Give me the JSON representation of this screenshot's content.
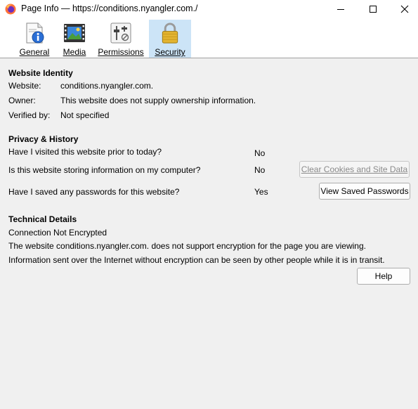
{
  "window": {
    "title": "Page Info — https://conditions.nyangler.com./",
    "icon": "firefox-icon",
    "minimize_icon": "minimize-icon",
    "maximize_icon": "maximize-icon",
    "close_icon": "close-icon"
  },
  "tabs": [
    {
      "label": "General",
      "icon": "general-page-icon",
      "selected": false
    },
    {
      "label": "Media",
      "icon": "media-film-icon",
      "selected": false
    },
    {
      "label": "Permissions",
      "icon": "permissions-sliders-icon",
      "selected": false
    },
    {
      "label": "Security",
      "icon": "padlock-icon",
      "selected": true
    }
  ],
  "identity": {
    "heading": "Website Identity",
    "website_label": "Website:",
    "website_value": "conditions.nyangler.com.",
    "owner_label": "Owner:",
    "owner_value": "This website does not supply ownership information.",
    "verified_label": "Verified by:",
    "verified_value": "Not specified"
  },
  "privacy": {
    "heading": "Privacy & History",
    "q1": "Have I visited this website prior to today?",
    "a1": "No",
    "q2": "Is this website storing information on my computer?",
    "a2": "No",
    "clear_button": "Clear Cookies and Site Data",
    "q3": "Have I saved any passwords for this website?",
    "a3": "Yes",
    "view_passwords_button": "View Saved Passwords"
  },
  "technical": {
    "heading": "Technical Details",
    "line1": "Connection Not Encrypted",
    "line2": "The website conditions.nyangler.com. does not support encryption for the page you are viewing.",
    "line3": "Information sent over the Internet without encryption can be seen by other people while it is in transit."
  },
  "help_button": "Help",
  "colors": {
    "selected_tab": "#cce4f7",
    "background": "#f0f0f0",
    "titlebar": "#ffffff"
  }
}
